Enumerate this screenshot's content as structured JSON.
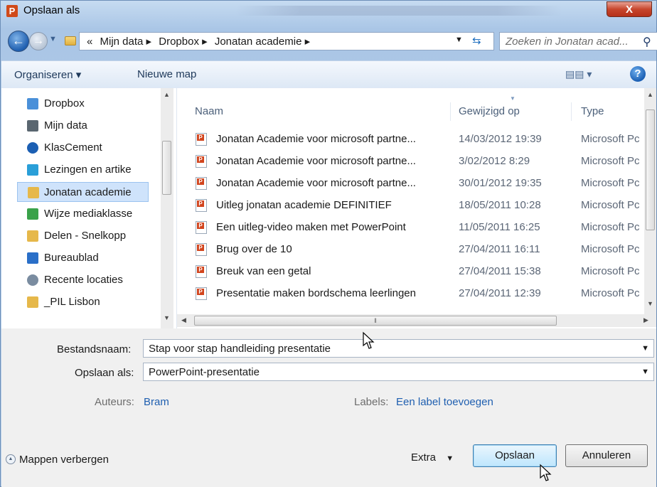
{
  "window": {
    "title": "Opslaan als",
    "app_icon": "P",
    "close_glyph": "X"
  },
  "address": {
    "breadcrumb": [
      "«",
      "Mijn data ▸",
      "Dropbox ▸",
      "Jonatan academie ▸"
    ],
    "search_placeholder": "Zoeken in Jonatan acad..."
  },
  "toolbar": {
    "organize": "Organiseren ▾",
    "new_folder": "Nieuwe map"
  },
  "nav": {
    "items": [
      {
        "label": "Dropbox",
        "icon": "dropbox-icon",
        "color": "#4a90d9"
      },
      {
        "label": "Mijn data",
        "icon": "drive-icon",
        "color": "#5a6670"
      },
      {
        "label": "KlasCement",
        "icon": "klascement-icon",
        "color": "#1b5fb3"
      },
      {
        "label": "Lezingen en artike",
        "icon": "cloud-icon",
        "color": "#2a9fd8"
      },
      {
        "label": "Jonatan academie",
        "icon": "folder-icon",
        "color": "#e6b84a"
      },
      {
        "label": "Wijze mediaklasse",
        "icon": "wijze-icon",
        "color": "#3aa24a"
      },
      {
        "label": "Delen - Snelkopp",
        "icon": "folder-icon",
        "color": "#e6b84a"
      },
      {
        "label": "Bureaublad",
        "icon": "desktop-icon",
        "color": "#2a6fc8"
      },
      {
        "label": "Recente locaties",
        "icon": "recent-icon",
        "color": "#7a8ca0"
      },
      {
        "label": "_PIL Lisbon",
        "icon": "folder-icon",
        "color": "#e6b84a"
      }
    ],
    "selected": "Jonatan academie"
  },
  "columns": {
    "name": "Naam",
    "modified": "Gewijzigd op",
    "type": "Type"
  },
  "files": [
    {
      "name": "Jonatan Academie voor microsoft partne...",
      "date": "14/03/2012 19:39",
      "type": "Microsoft Pc"
    },
    {
      "name": "Jonatan Academie voor microsoft partne...",
      "date": "3/02/2012 8:29",
      "type": "Microsoft Pc"
    },
    {
      "name": "Jonatan Academie voor microsoft partne...",
      "date": "30/01/2012 19:35",
      "type": "Microsoft Pc"
    },
    {
      "name": "Uitleg jonatan academie DEFINITIEF",
      "date": "18/05/2011 10:28",
      "type": "Microsoft Pc"
    },
    {
      "name": "Een uitleg-video maken met PowerPoint",
      "date": "11/05/2011 16:25",
      "type": "Microsoft Pc"
    },
    {
      "name": "Brug over de 10",
      "date": "27/04/2011 16:11",
      "type": "Microsoft Pc"
    },
    {
      "name": "Breuk van een getal",
      "date": "27/04/2011 15:38",
      "type": "Microsoft Pc"
    },
    {
      "name": "Presentatie maken bordschema leerlingen",
      "date": "27/04/2011 12:39",
      "type": "Microsoft Pc"
    }
  ],
  "form": {
    "filename_label": "Bestandsnaam:",
    "filename_value": "Stap voor stap handleiding presentatie",
    "savetype_label": "Opslaan als:",
    "savetype_value": "PowerPoint-presentatie",
    "authors_label": "Auteurs:",
    "authors_value": "Bram",
    "labels_label": "Labels:",
    "labels_value": "Een label toevoegen"
  },
  "footer": {
    "hide_folders": "Mappen verbergen",
    "extra": "Extra",
    "save": "Opslaan",
    "cancel": "Annuleren"
  }
}
